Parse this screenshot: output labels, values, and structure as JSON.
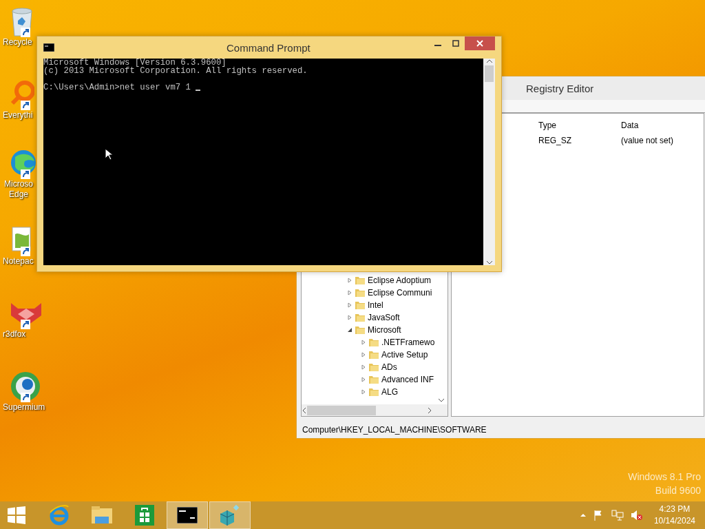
{
  "desktop_icons": [
    {
      "label": "Recycle",
      "kind": "recycle"
    },
    {
      "label": "Everythi",
      "kind": "search"
    },
    {
      "label": "Microso Edge",
      "kind": "edge"
    },
    {
      "label": "Notepac",
      "kind": "notepad"
    },
    {
      "label": "r3dfox",
      "kind": "fox"
    },
    {
      "label": "Supermium",
      "kind": "browser"
    }
  ],
  "registry_editor": {
    "title": "Registry Editor",
    "columns": [
      "Type",
      "Data"
    ],
    "rows": [
      {
        "type": "REG_SZ",
        "data": "(value not set)"
      }
    ],
    "tree": [
      {
        "label": "Eclipse Adoptium",
        "expanded": false
      },
      {
        "label": "Eclipse Communi",
        "expanded": false
      },
      {
        "label": "Intel",
        "expanded": false
      },
      {
        "label": "JavaSoft",
        "expanded": false
      },
      {
        "label": "Microsoft",
        "expanded": true,
        "children": [
          {
            "label": ".NETFramewo",
            "expanded": false
          },
          {
            "label": "Active Setup",
            "expanded": false
          },
          {
            "label": "ADs",
            "expanded": false
          },
          {
            "label": "Advanced INF",
            "expanded": false
          },
          {
            "label": "ALG",
            "expanded": false
          }
        ]
      }
    ],
    "status_bar": "Computer\\HKEY_LOCAL_MACHINE\\SOFTWARE"
  },
  "command_prompt": {
    "title": "Command Prompt",
    "output": [
      "Microsoft Windows [Version 6.3.9600]",
      "(c) 2013 Microsoft Corporation. All rights reserved."
    ],
    "prompt": "C:\\Users\\Admin>net user vm7 1"
  },
  "watermark": [
    "Windows 8.1 Pro",
    "Build 9600"
  ],
  "taskbar": {
    "items": [
      {
        "kind": "start",
        "running": false
      },
      {
        "kind": "ie",
        "running": false
      },
      {
        "kind": "explorer",
        "running": false
      },
      {
        "kind": "store",
        "running": false
      },
      {
        "kind": "cmd",
        "running": true
      },
      {
        "kind": "regedit",
        "running": true
      }
    ],
    "time": "4:23 PM",
    "date": "10/14/2024"
  }
}
